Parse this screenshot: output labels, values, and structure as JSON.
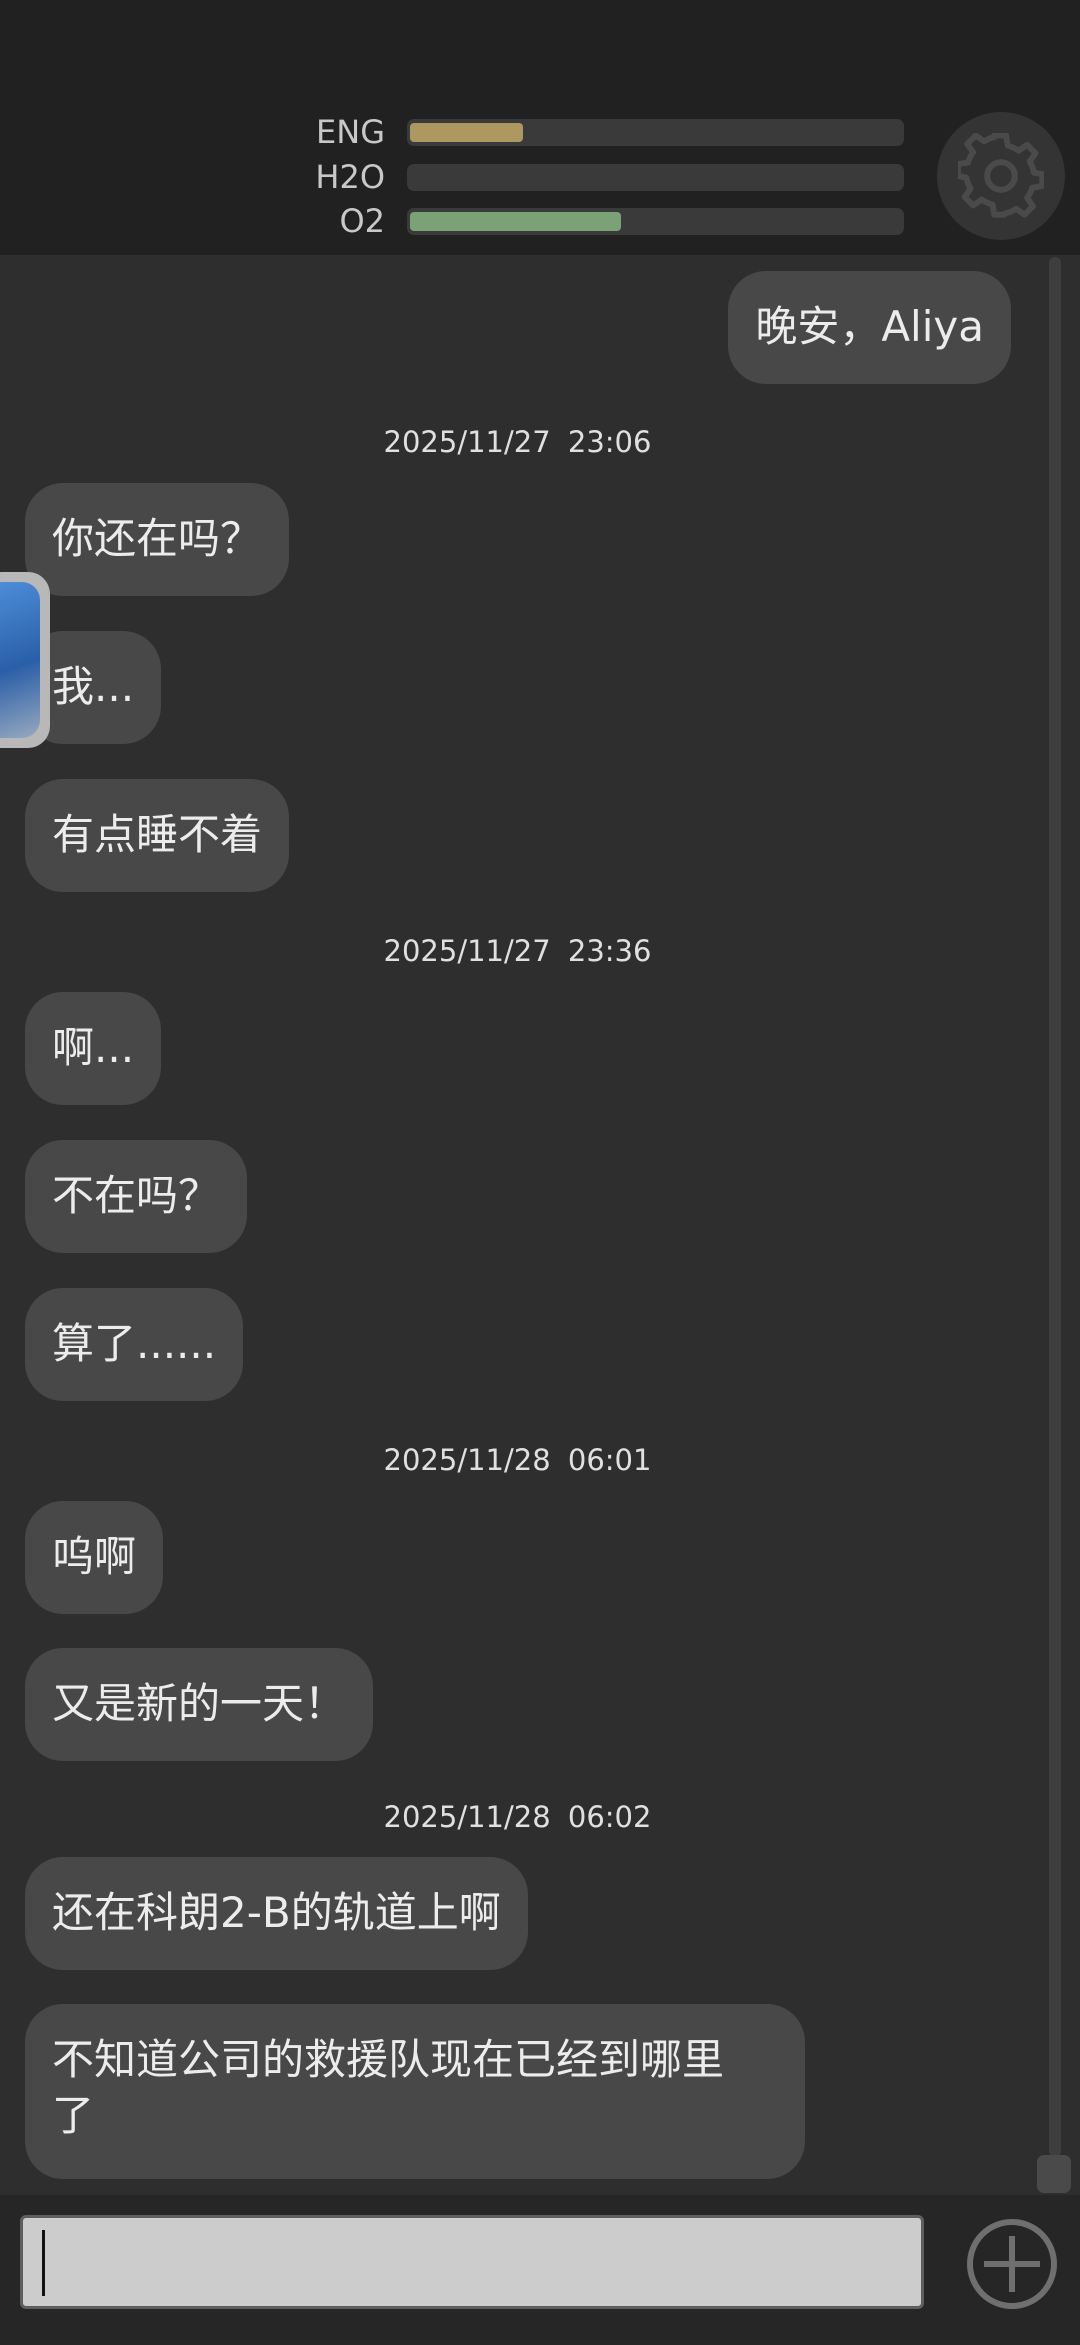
{
  "status": {
    "eng": {
      "label": "ENG",
      "level": 0.23,
      "color": "#ad9860"
    },
    "h2o": {
      "label": "H2O",
      "level": 0.0,
      "color": "#6a6a6a"
    },
    "o2": {
      "label": "O2",
      "level": 0.43,
      "color": "#7ba276"
    }
  },
  "settings_icon": "gear-icon",
  "messages": [
    {
      "type": "sent",
      "text": "晚安，Aliya"
    },
    {
      "type": "timestamp",
      "text": "2025/11/27  23:06"
    },
    {
      "type": "received",
      "text": "你还在吗？"
    },
    {
      "type": "received",
      "text": "我..."
    },
    {
      "type": "received",
      "text": "有点睡不着"
    },
    {
      "type": "timestamp",
      "text": "2025/11/27  23:36"
    },
    {
      "type": "received",
      "text": "啊..."
    },
    {
      "type": "received",
      "text": "不在吗？"
    },
    {
      "type": "received",
      "text": "算了......"
    },
    {
      "type": "timestamp",
      "text": "2025/11/28  06:01"
    },
    {
      "type": "received",
      "text": "呜啊"
    },
    {
      "type": "received",
      "text": "又是新的一天！"
    },
    {
      "type": "timestamp",
      "text": "2025/11/28  06:02"
    },
    {
      "type": "received",
      "text": "还在科朗2-B的轨道上啊"
    },
    {
      "type": "received",
      "text": "不知道公司的救援队现在已经到哪里\n了"
    }
  ],
  "input": {
    "value": "",
    "placeholder": ""
  },
  "add_icon": "plus-circle-icon",
  "colors": {
    "bubble": "#484848",
    "background": "#2e2e2e",
    "header": "#212121"
  }
}
